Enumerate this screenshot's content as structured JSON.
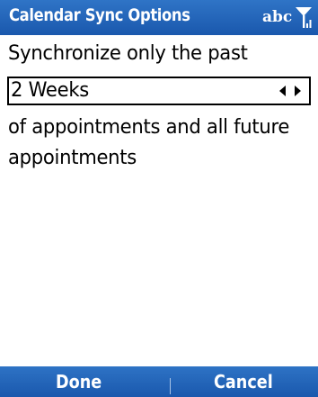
{
  "title_bar": {
    "title": "Calendar Sync Options",
    "input_mode": "abc",
    "signal_icon": "signal-strength-icon"
  },
  "main": {
    "prompt": "Synchronize only the past",
    "picker": {
      "value": "2 Weeks",
      "arrows_icon": "left-right-arrows-icon"
    },
    "description_lines": [
      "of appointments and all future",
      "appointments"
    ]
  },
  "softkeys": {
    "left_label": "Done",
    "right_label": "Cancel"
  },
  "colors": {
    "bar_blue": "#1f5fb4",
    "text": "#000000",
    "background": "#ffffff"
  }
}
